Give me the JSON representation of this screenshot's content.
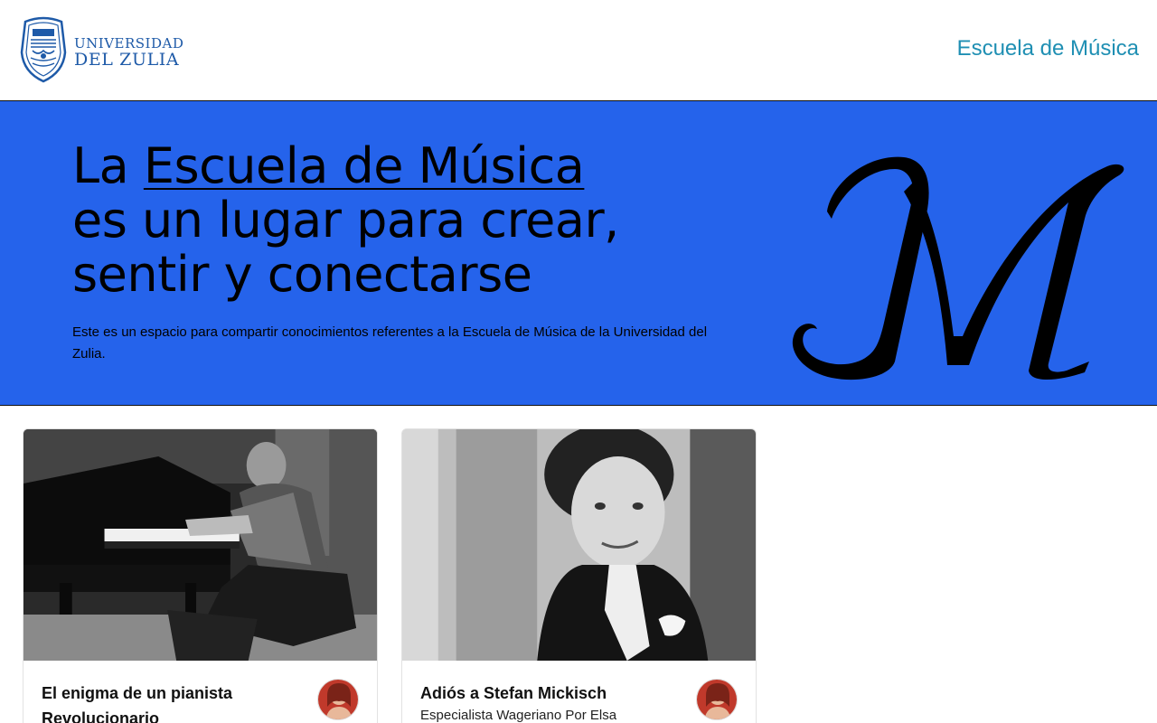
{
  "header": {
    "logo_line1": "UNIVERSIDAD",
    "logo_line2": "DEL ZULIA",
    "nav_title": "Escuela de Música"
  },
  "hero": {
    "heading_prefix": "La ",
    "heading_highlight": "Escuela de Música",
    "heading_line2": "es un lugar para crear,",
    "heading_line3": "sentir y conectarse",
    "description": "Este es un espacio para compartir conocimientos referentes a la Escuela de Música de la Universidad del Zulia.",
    "accent_color": "#2563eb"
  },
  "posts": [
    {
      "title": "El enigma de un pianista Revolucionario",
      "subtitle": "",
      "image_icon": "pianist-photo",
      "avatar_icon": "author-avatar"
    },
    {
      "title": "Adiós a Stefan Mickisch",
      "subtitle": "Especialista Wageriano Por Elsa",
      "image_icon": "portrait-photo",
      "avatar_icon": "author-avatar"
    }
  ],
  "colors": {
    "brand_blue": "#1e5aa8",
    "nav_link": "#1f8fb3",
    "hero_bg": "#2563eb"
  }
}
